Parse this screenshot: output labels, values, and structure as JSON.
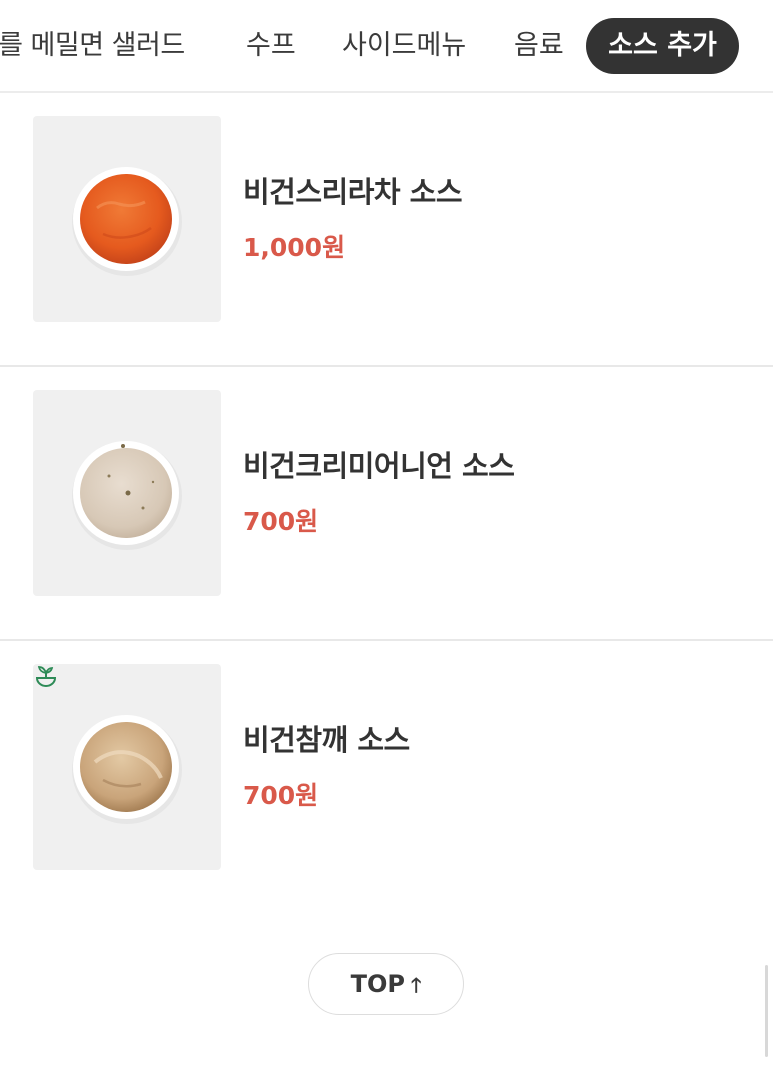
{
  "tabs": [
    {
      "label": "~를 메밀면 샐러드",
      "active": false
    },
    {
      "label": "수프",
      "active": false
    },
    {
      "label": "사이드메뉴",
      "active": false
    },
    {
      "label": "음료",
      "active": false
    },
    {
      "label": "소스 추가",
      "active": true
    }
  ],
  "products": [
    {
      "name": "비건스리라차 소스",
      "price": "1,000원",
      "image_icon": "sriracha-sauce-bowl",
      "vegan_badge": false
    },
    {
      "name": "비건크리미어니언 소스",
      "price": "700원",
      "image_icon": "creamy-onion-sauce-bowl",
      "vegan_badge": false
    },
    {
      "name": "비건참깨 소스",
      "price": "700원",
      "image_icon": "sesame-sauce-bowl",
      "vegan_badge": true
    }
  ],
  "top_button": {
    "label": "TOP",
    "icon": "arrow-up-icon",
    "arrow": "🡑"
  },
  "colors": {
    "price": "#d9594a",
    "active_tab_bg": "#333333",
    "vegan_badge": "#2e8b57"
  }
}
